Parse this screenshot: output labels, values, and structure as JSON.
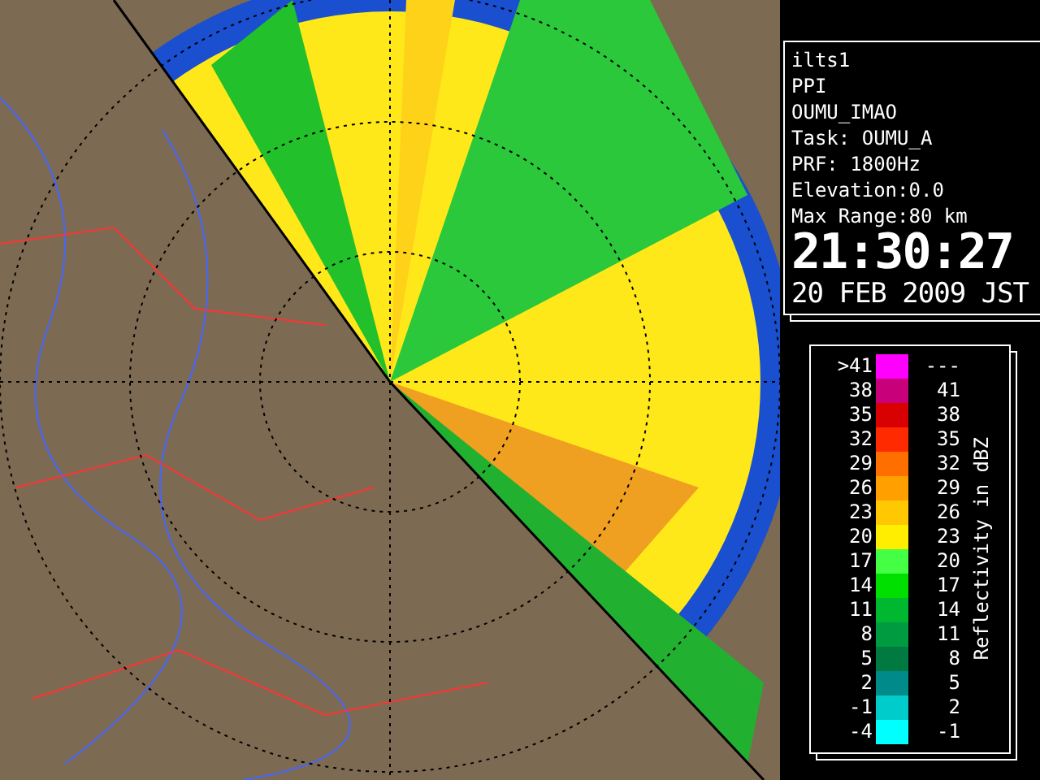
{
  "info": {
    "lines": [
      "ilts1",
      "PPI",
      "OUMU_IMAO",
      "Task: OUMU_A",
      "PRF: 1800Hz",
      "Elevation:0.0",
      "Max Range:80 km"
    ],
    "time": "21:30:27",
    "date": "20 FEB 2009 JST"
  },
  "legend": {
    "title": "Reflectivity in dBZ",
    "rows": [
      {
        "low": ">41",
        "high": "---",
        "color": "#ff00ff"
      },
      {
        "low": "38",
        "high": "41",
        "color": "#c8007a"
      },
      {
        "low": "35",
        "high": "38",
        "color": "#d80000"
      },
      {
        "low": "32",
        "high": "35",
        "color": "#ff2a00"
      },
      {
        "low": "29",
        "high": "32",
        "color": "#ff6f00"
      },
      {
        "low": "26",
        "high": "29",
        "color": "#ffa000"
      },
      {
        "low": "23",
        "high": "26",
        "color": "#ffc800"
      },
      {
        "low": "20",
        "high": "23",
        "color": "#ffee00"
      },
      {
        "low": "17",
        "high": "20",
        "color": "#44ff44"
      },
      {
        "low": "14",
        "high": "17",
        "color": "#00e000"
      },
      {
        "low": "11",
        "high": "14",
        "color": "#00b830"
      },
      {
        "low": "8",
        "high": "11",
        "color": "#009a40"
      },
      {
        "low": "5",
        "high": "8",
        "color": "#007a40"
      },
      {
        "low": "2",
        "high": "5",
        "color": "#008a8a"
      },
      {
        "low": "-1",
        "high": "2",
        "color": "#00cccc"
      },
      {
        "low": "-4",
        "high": "-1",
        "color": "#00ffff"
      }
    ]
  }
}
